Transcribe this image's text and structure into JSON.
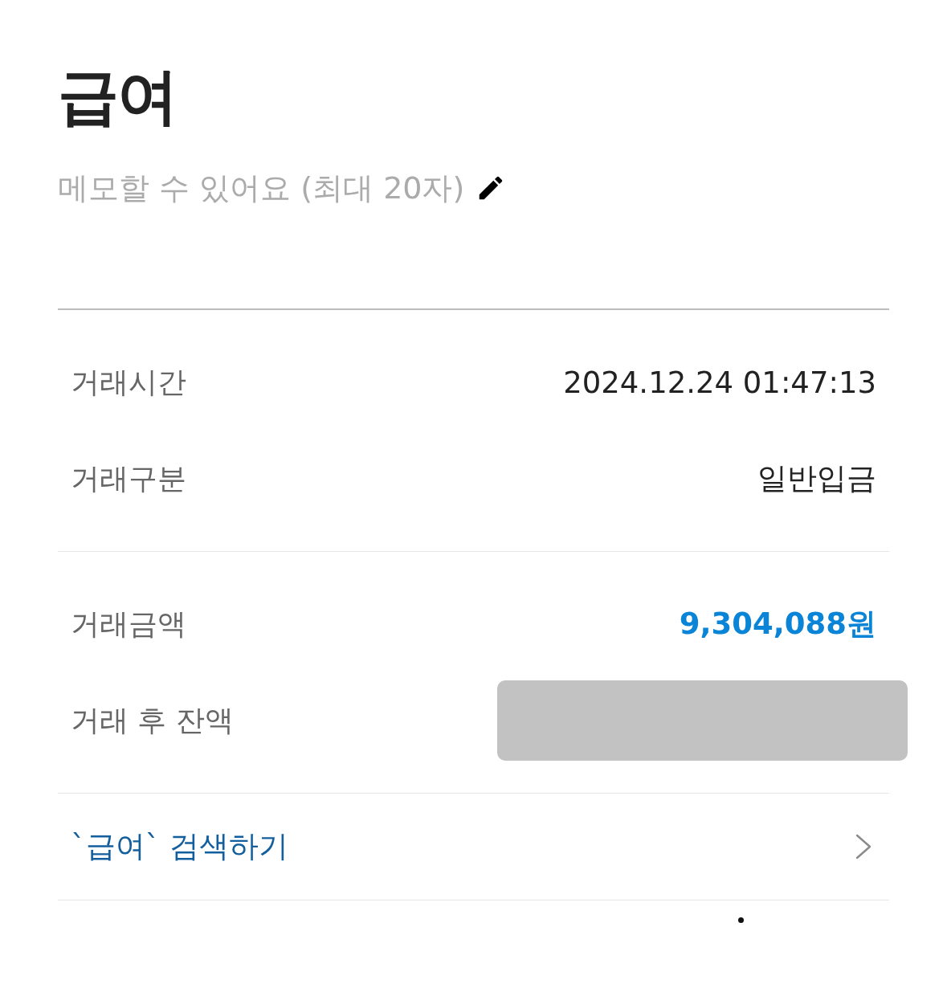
{
  "title": "급여",
  "memo": {
    "prompt": "메모할 수 있어요 (최대 20자)"
  },
  "detail_groups": [
    {
      "rows": [
        {
          "kind": "text",
          "label": "거래시간",
          "value": "2024.12.24 01:47:13"
        },
        {
          "kind": "text",
          "label": "거래구분",
          "value": "일반입금"
        }
      ]
    },
    {
      "rows": [
        {
          "kind": "amount",
          "label": "거래금액",
          "value": "9,304,088원"
        },
        {
          "kind": "redacted",
          "label": "거래 후 잔액"
        }
      ]
    }
  ],
  "search_link": {
    "label": "`급여` 검색하기"
  }
}
